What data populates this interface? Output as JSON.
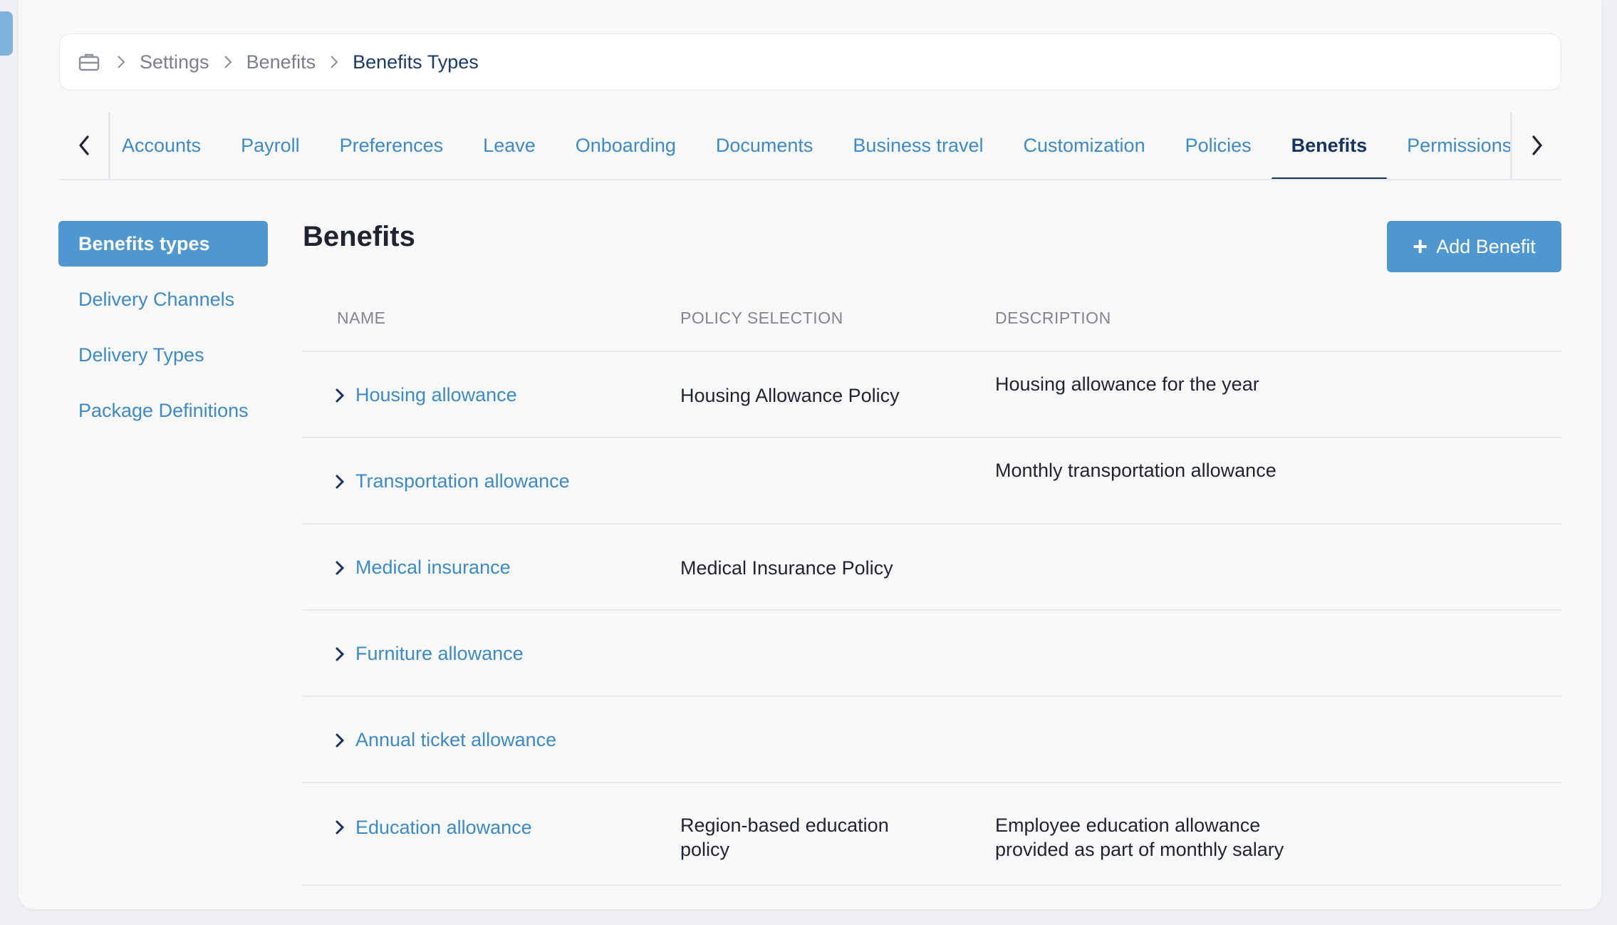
{
  "breadcrumb": {
    "icon": "briefcase-icon",
    "items": [
      "Settings",
      "Benefits"
    ],
    "current": "Benefits Types"
  },
  "tabs": [
    {
      "label": "Accounts",
      "active": false
    },
    {
      "label": "Payroll",
      "active": false
    },
    {
      "label": "Preferences",
      "active": false
    },
    {
      "label": "Leave",
      "active": false
    },
    {
      "label": "Onboarding",
      "active": false
    },
    {
      "label": "Documents",
      "active": false
    },
    {
      "label": "Business travel",
      "active": false
    },
    {
      "label": "Customization",
      "active": false
    },
    {
      "label": "Policies",
      "active": false
    },
    {
      "label": "Benefits",
      "active": true
    },
    {
      "label": "Permissions",
      "active": false
    }
  ],
  "leftnav": {
    "items": [
      "Benefits types",
      "Delivery Channels",
      "Delivery Types",
      "Package Definitions"
    ]
  },
  "main": {
    "title": "Benefits",
    "add_button": "Add Benefit"
  },
  "table": {
    "headers": {
      "name": "NAME",
      "policy": "POLICY SELECTION",
      "description": "DESCRIPTION"
    },
    "rows": [
      {
        "name": "Housing allowance",
        "policy": "Housing Allowance Policy",
        "description": "Housing allowance for the year"
      },
      {
        "name": "Transportation allowance",
        "policy": "",
        "description": "Monthly transportation allowance"
      },
      {
        "name": "Medical insurance",
        "policy": "Medical Insurance Policy",
        "description": ""
      },
      {
        "name": "Furniture allowance",
        "policy": "",
        "description": ""
      },
      {
        "name": "Annual ticket allowance",
        "policy": "",
        "description": ""
      },
      {
        "name": "Education allowance",
        "policy": "Region-based education policy",
        "description": "Employee education allowance provided as part of monthly salary"
      }
    ]
  },
  "colors": {
    "accent": "#4f97d0",
    "link": "#3c8ac9",
    "active_tab": "#16325f"
  }
}
